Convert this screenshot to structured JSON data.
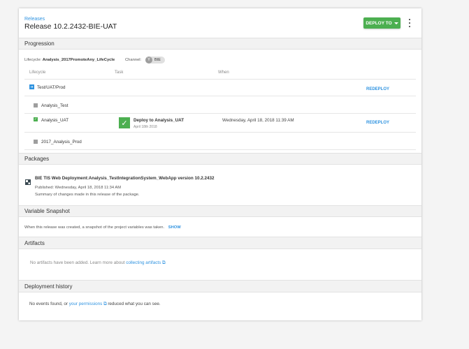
{
  "header": {
    "breadcrumb": "Releases",
    "title": "Release 10.2.2432-BIE-UAT",
    "deploy_button": "DEPLOY TO"
  },
  "progression": {
    "heading": "Progression",
    "lifecycle_label": "Lifecycle:",
    "lifecycle_value": "Analysis_2017PromoteAny_LifeCycle",
    "channel_label": "Channel:",
    "channel_icon": "Y",
    "channel_value": "BIE",
    "columns": [
      "Lifecycle",
      "Task",
      "When"
    ],
    "rows": [
      {
        "name": "Test/UAT/Prod",
        "action": "REDEPLOY"
      },
      {
        "name": "Analysis_Test"
      },
      {
        "name": "Analysis_UAT",
        "task": "Deploy to Analysis_UAT",
        "task_date": "April 18th 2018",
        "when": "Wednesday, April 18, 2018 11:39 AM",
        "action": "REDEPLOY"
      },
      {
        "name": "2017_Analysis_Prod"
      }
    ]
  },
  "packages": {
    "heading": "Packages",
    "name": "BIE TIS Web Deployment:Analysis_TestIntegrationSystem_WebApp version 10.2.2432",
    "published": "Published: Wednesday, April 18, 2018 11:34 AM",
    "summary": "Summary of changes made in this release of the package."
  },
  "variable_snapshot": {
    "heading": "Variable Snapshot",
    "text": "When this release was created, a snapshot of the project variables was taken.",
    "show_link": "SHOW"
  },
  "artifacts": {
    "heading": "Artifacts",
    "text": "No artifacts have been added. Learn more about",
    "link": "collecting artifacts"
  },
  "deployment_history": {
    "heading": "Deployment history",
    "text_pre": "No events found, or",
    "link": "your permissions",
    "text_post": "reduced what you can see."
  },
  "colors": {
    "accent": "#2f93e0",
    "success": "#4caf50",
    "phase_blue": "#2f93e0",
    "pending_gray": "#9e9e9e"
  }
}
